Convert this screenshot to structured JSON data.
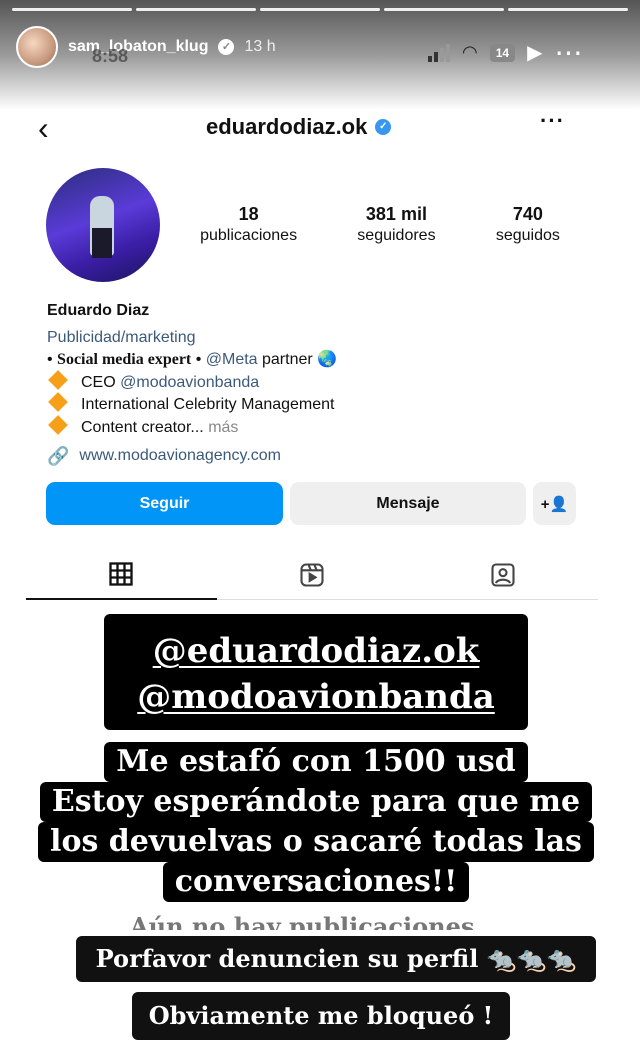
{
  "story": {
    "username": "sam_lobaton_klug",
    "time_ago": "13 h",
    "phone_time": "8:58",
    "battery": "14"
  },
  "profile": {
    "handle": "eduardodiaz.ok",
    "stats": [
      {
        "value": "18",
        "label": "publicaciones"
      },
      {
        "value": "381 mil",
        "label": "seguidores"
      },
      {
        "value": "740",
        "label": "seguidos"
      }
    ],
    "name": "Eduardo Diaz",
    "category": "Publicidad/marketing",
    "bio_line1_prefix": "• ",
    "bio_line1_bold": "Social media expert",
    "bio_line1_sep": " • ",
    "bio_line1_mention": "@Meta",
    "bio_line1_suffix": " partner 🌏",
    "bio_line2_prefix": "CEO ",
    "bio_line2_mention": "@modoavionbanda",
    "bio_line3": "International Celebrity Management",
    "bio_line4": "Content creator...",
    "bio_more": "más",
    "website": "www.modoavionagency.com",
    "follow_label": "Seguir",
    "message_label": "Mensaje",
    "add_user_label": "+👤"
  },
  "stickers": {
    "handle1": "@eduardodiaz.ok",
    "handle2": "@modoavionbanda",
    "main_lines": [
      "Me estafó con 1500 usd",
      "Estoy esperándote para que me",
      "los devuelvas o sacaré todas las",
      "conversaciones!!"
    ],
    "ghost_text": "Aún no hay publicaciones",
    "report": "Porfavor denuncien su perfil 🐀🐀🐀",
    "blocked": "Obviamente  me bloqueó !"
  }
}
